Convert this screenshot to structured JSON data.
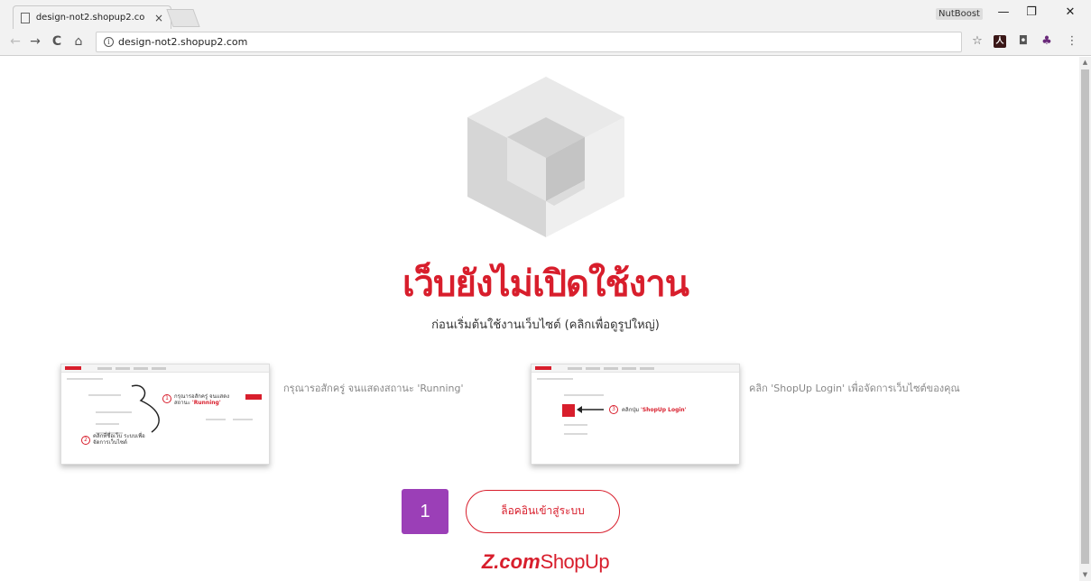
{
  "browser": {
    "tab_title": "design-not2.shopup2.co",
    "tab_close": "×",
    "user_badge": "NutBoost",
    "window_minimize": "—",
    "window_restore": "❐",
    "window_close": "✕",
    "url": "design-not2.shopup2.com",
    "back": "←",
    "forward": "→",
    "reload": "C",
    "home": "⌂",
    "info_icon": "i",
    "star": "☆",
    "pdf": "人",
    "camera": "◘",
    "extension": "♣",
    "menu": "⋮"
  },
  "page": {
    "headline": "เว็บยังไม่เปิดใช้งาน",
    "subhead": "ก่อนเริ่มต้นใช้งานเว็บไซต์ (คลิกเพื่อดูรูปใหญ่)",
    "step_a_text": "กรุณารอสักครู่ จนแสดงสถานะ 'Running'",
    "step_b_text": "คลิก 'ShopUp Login' เพื่อจัดการเว็บไซต์ของคุณ",
    "thumb_a": {
      "circle_1": "1",
      "note_1": "กรุณารอสักครู่ จนแสดงสถานะ",
      "note_1_em": "'Running'",
      "circle_2": "2",
      "note_2": "คลิกที่ชื่อเว็บ ระบบเพื่อจัดการเว็บไซต์"
    },
    "thumb_b": {
      "circle_3": "3",
      "note_3": "คลิกปุ่ม",
      "note_3_em": "'ShopUp Login'"
    },
    "step_number": "1",
    "login_button": "ล็อคอินเข้าสู่ระบบ",
    "brand_z": "Z.com",
    "brand_shopup": "ShopUp"
  },
  "colors": {
    "accent_red": "#d81e2c",
    "step_purple": "#9b3fb7"
  }
}
